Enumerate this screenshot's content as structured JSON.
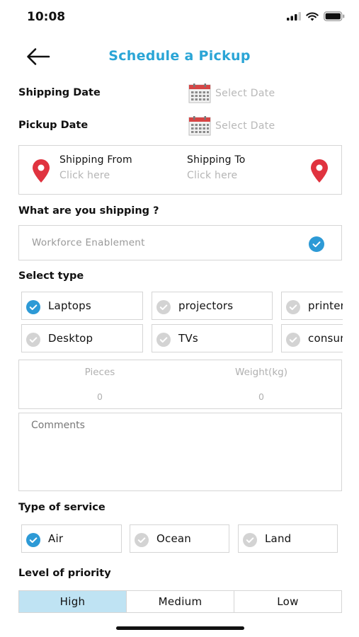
{
  "status_bar": {
    "time": "10:08"
  },
  "header": {
    "title": "Schedule a Pickup"
  },
  "shipping_date": {
    "label": "Shipping Date",
    "placeholder": "Select Date"
  },
  "pickup_date": {
    "label": "Pickup Date",
    "placeholder": "Select Date"
  },
  "route": {
    "from_label": "Shipping From",
    "from_value": "Click here",
    "to_label": "Shipping To",
    "to_value": "Click here"
  },
  "what_shipping": {
    "label": "What are you shipping ?",
    "value": "Workforce Enablement"
  },
  "select_type": {
    "label": "Select type",
    "options": [
      {
        "label": "Laptops",
        "checked": true
      },
      {
        "label": "projectors",
        "checked": false
      },
      {
        "label": "printers",
        "checked": false
      },
      {
        "label": "Desktop",
        "checked": false
      },
      {
        "label": "TVs",
        "checked": false
      },
      {
        "label": "consumables",
        "checked": false
      }
    ]
  },
  "quantity": {
    "pieces_label": "Pieces",
    "pieces_value": "0",
    "weight_label": "Weight(kg)",
    "weight_value": "0"
  },
  "comments": {
    "placeholder": "Comments"
  },
  "service": {
    "label": "Type of service",
    "options": [
      {
        "label": "Air",
        "checked": true
      },
      {
        "label": "Ocean",
        "checked": false
      },
      {
        "label": "Land",
        "checked": false
      }
    ]
  },
  "priority": {
    "label": "Level of priority",
    "options": [
      "High",
      "Medium",
      "Low"
    ],
    "selected": "High"
  },
  "colors": {
    "accent": "#2aa5d6",
    "pin_red": "#e0333f",
    "selected_tab": "#bfe3f3",
    "check_on": "#2d9ad6",
    "check_off": "#d3d3d3"
  }
}
